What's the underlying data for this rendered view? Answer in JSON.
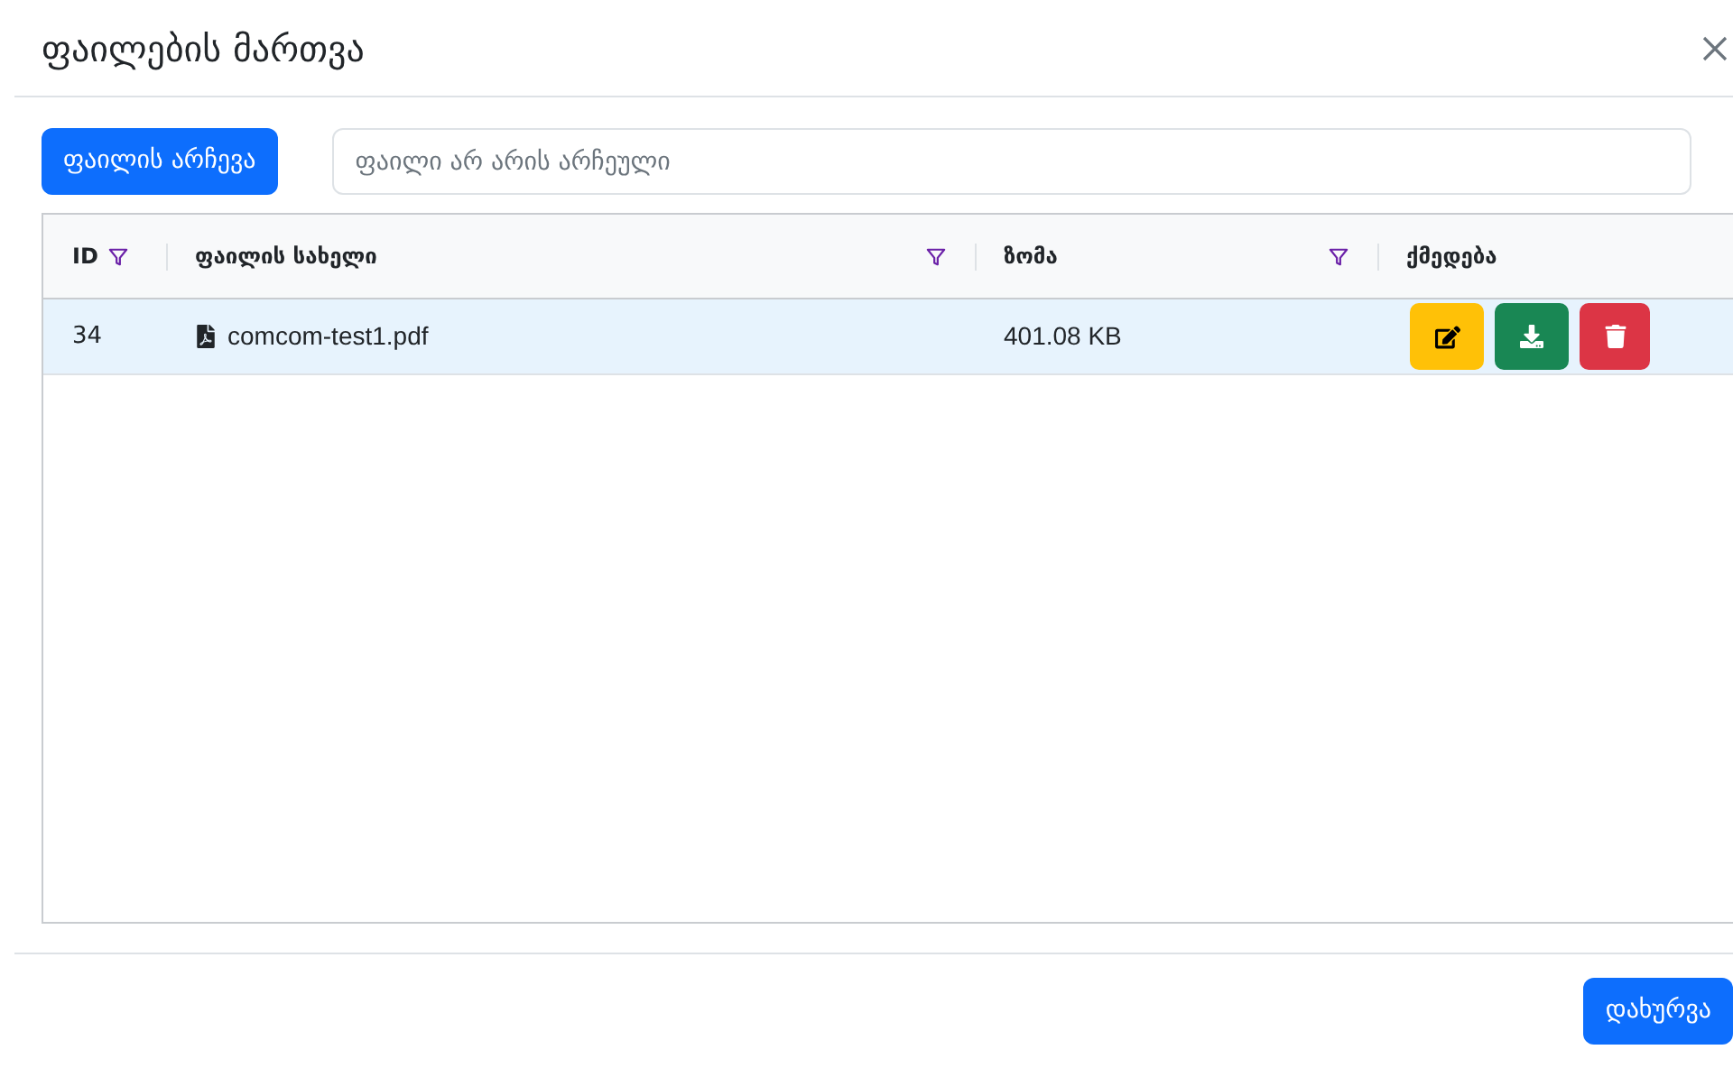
{
  "dialog": {
    "title": "ფაილების მართვა"
  },
  "file_picker": {
    "button": "ფაილის არჩევა",
    "placeholder": "ფაილი არ არის არჩეული"
  },
  "table": {
    "columns": [
      {
        "label": "ID",
        "filter": true
      },
      {
        "label": "ფაილის სახელი",
        "filter": true
      },
      {
        "label": "ზომა",
        "filter": true
      },
      {
        "label": "ქმედება",
        "filter": false
      }
    ],
    "rows": [
      {
        "id": "34",
        "name": "comcom-test1.pdf",
        "size": "401.08 KB",
        "selected": true
      }
    ]
  },
  "footer": {
    "close_button": "დახურვა"
  }
}
